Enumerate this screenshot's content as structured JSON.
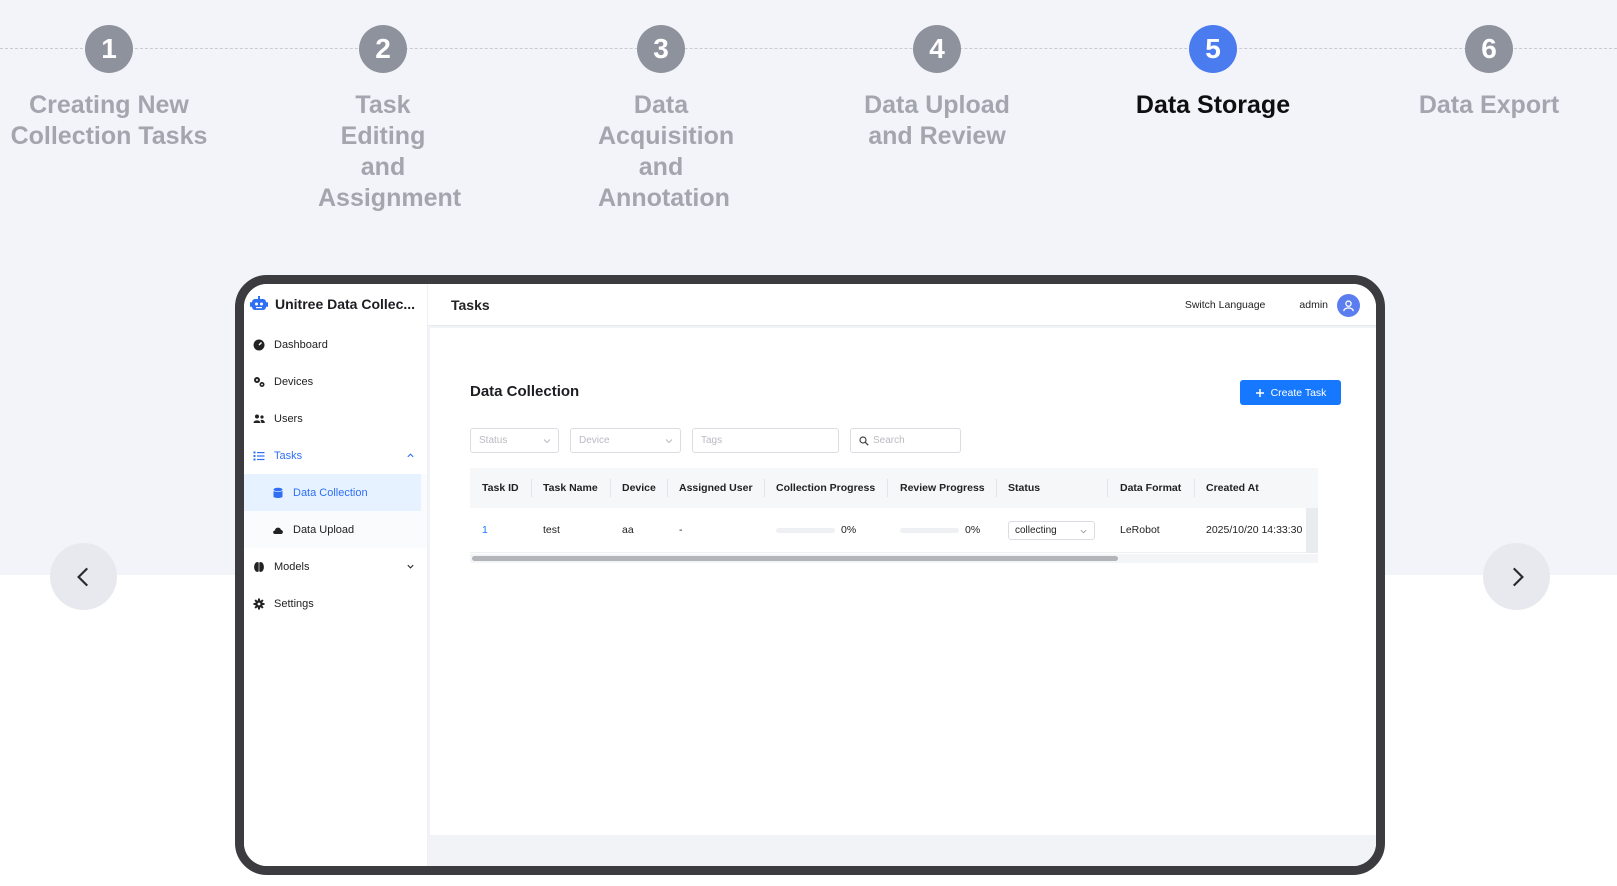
{
  "steps": [
    {
      "number": "1",
      "label": "Creating New Collection Tasks"
    },
    {
      "number": "2",
      "label": "Task Editing and Assignment"
    },
    {
      "number": "3",
      "label": "Data Acquisition and Annotation"
    },
    {
      "number": "4",
      "label": "Data Upload and Review"
    },
    {
      "number": "5",
      "label": "Data Storage",
      "active": true
    },
    {
      "number": "6",
      "label": "Data Export"
    }
  ],
  "carousel": {
    "prev_icon": "chevron-left-icon",
    "next_icon": "chevron-right-icon"
  },
  "app": {
    "brand": "Unitree Data Collec...",
    "sidebar": [
      {
        "label": "Dashboard",
        "icon": "dashboard-icon"
      },
      {
        "label": "Devices",
        "icon": "gears-icon"
      },
      {
        "label": "Users",
        "icon": "users-icon"
      },
      {
        "label": "Tasks",
        "icon": "list-icon",
        "expanded": true
      },
      {
        "label": "Data Collection",
        "icon": "database-icon",
        "selected": true
      },
      {
        "label": "Data Upload",
        "icon": "cloud-icon"
      },
      {
        "label": "Models",
        "icon": "models-icon"
      },
      {
        "label": "Settings",
        "icon": "gear-icon"
      }
    ],
    "header": {
      "title": "Tasks",
      "switch_language": "Switch Language",
      "user": "admin"
    },
    "page_title": "Data Collection",
    "create_button": "Create Task",
    "filters": {
      "status": "Status",
      "device": "Device",
      "tags": "Tags",
      "search": "Search"
    },
    "table": {
      "columns": [
        "Task ID",
        "Task Name",
        "Device",
        "Assigned User",
        "Collection Progress",
        "Review Progress",
        "Status",
        "Data Format",
        "Created At"
      ],
      "rows": [
        {
          "task_id": "1",
          "task_name": "test",
          "device": "aa",
          "assigned_user": "-",
          "collection_progress": 0,
          "collection_progress_label": "0%",
          "review_progress": 0,
          "review_progress_label": "0%",
          "status": "collecting",
          "data_format": "LeRobot",
          "created_at": "2025/10/20 14:33:30"
        }
      ]
    },
    "colors": {
      "primary": "#1677ff",
      "step_active": "#4a7cf0",
      "step_inactive": "#8e929c"
    }
  }
}
